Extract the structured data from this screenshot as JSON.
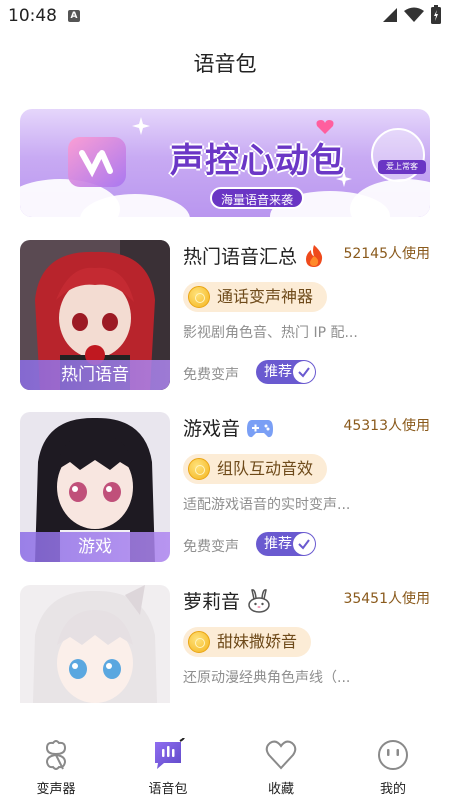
{
  "status": {
    "time": "10:48",
    "notification_letter": "A"
  },
  "page": {
    "title": "语音包"
  },
  "banner": {
    "title": "声控心动包",
    "subtitle": "海量语音来袭",
    "tag": "爱上常客"
  },
  "cards": [
    {
      "title": "热门语音汇总",
      "users": "52145人使用",
      "tag": "通话变声神器",
      "desc": "影视剧角色音、热门 IP 配...",
      "free": "免费变声",
      "badge": "推荐",
      "thumb_label": "热门语音",
      "title_icon": "fire-icon"
    },
    {
      "title": "游戏音",
      "users": "45313人使用",
      "tag": "组队互动音效",
      "desc": "适配游戏语音的实时变声...",
      "free": "免费变声",
      "badge": "推荐",
      "thumb_label": "游戏",
      "title_icon": "gamepad-icon"
    },
    {
      "title": "萝莉音",
      "users": "35451人使用",
      "tag": "甜妹撒娇音",
      "desc": "还原动漫经典角色声线（...",
      "title_icon": "bunny-icon"
    }
  ],
  "tabbar": {
    "items": [
      {
        "label": "变声器",
        "icon": "clover-icon",
        "active": false
      },
      {
        "label": "语音包",
        "icon": "voice-pack-icon",
        "active": true
      },
      {
        "label": "收藏",
        "icon": "heart-icon",
        "active": false
      },
      {
        "label": "我的",
        "icon": "face-icon",
        "active": false
      }
    ]
  },
  "colors": {
    "accent": "#6a5ad0",
    "banner_purple": "#6b37c6",
    "tag_bg": "#fcecd6",
    "users_text": "#8a5a1c"
  }
}
